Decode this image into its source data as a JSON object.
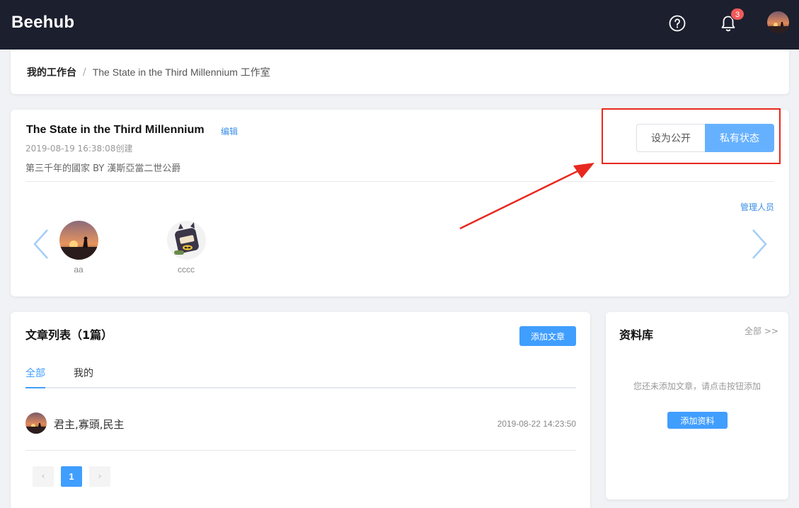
{
  "header": {
    "logo": "Beehub",
    "notification_count": "3",
    "icons": [
      "help-icon",
      "bell-icon",
      "user-avatar"
    ]
  },
  "breadcrumb": {
    "home": "我的工作台",
    "separator": "/",
    "current": "The State in the Third Millennium 工作室"
  },
  "studio": {
    "title": "The State in the Third Millennium",
    "edit_label": "编辑",
    "created": "2019-08-19 16:38:08创建",
    "description": "第三千年的國家 BY 漢斯亞當二世公爵",
    "visibility": {
      "public_label": "设为公开",
      "private_label": "私有状态",
      "active": "private"
    },
    "manage_label": "管理人员",
    "members": [
      {
        "name": "aa"
      },
      {
        "name": "cccc"
      }
    ]
  },
  "articles": {
    "title": "文章列表（1篇）",
    "add_label": "添加文章",
    "tabs": [
      {
        "label": "全部",
        "active": true
      },
      {
        "label": "我的",
        "active": false
      }
    ],
    "items": [
      {
        "title": "君主,寡頭,民主",
        "time": "2019-08-22 14:23:50"
      }
    ],
    "pagination": {
      "prev": "‹",
      "current": "1",
      "next": "›"
    }
  },
  "library": {
    "title": "资料库",
    "all_label": "全部 >>",
    "empty_text": "您还未添加文章，请点击按钮添加",
    "add_label": "添加资料"
  },
  "colors": {
    "header_bg": "#1c1f2e",
    "accent": "#409eff",
    "private_btn": "#66b1ff",
    "badge": "#f05a5a",
    "annotation": "#e8281e"
  }
}
